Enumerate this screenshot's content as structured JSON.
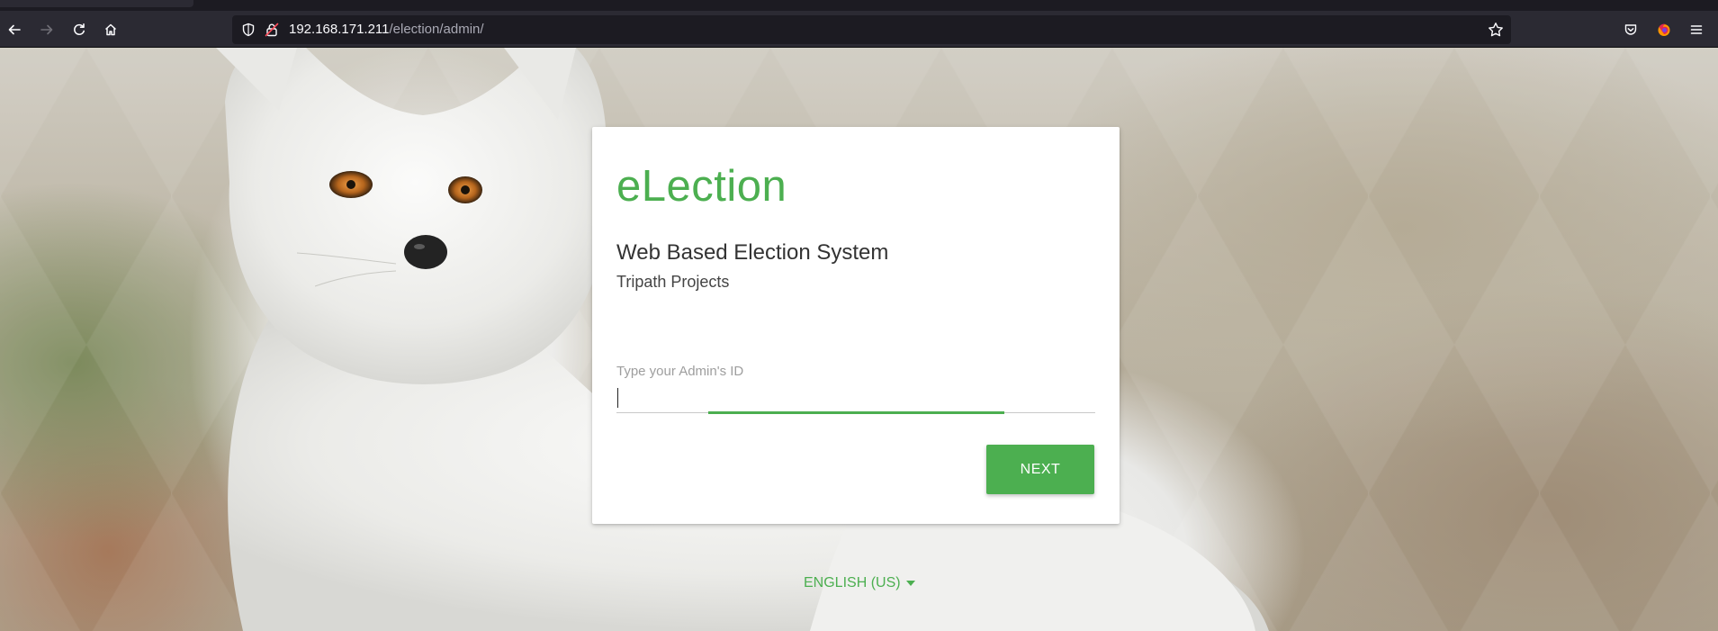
{
  "browser": {
    "url_host": "192.168.171.211",
    "url_path": "/election/admin/"
  },
  "card": {
    "brand": "eLection",
    "subtitle": "Web Based Election System",
    "organization": "Tripath Projects",
    "field_label": "Type your Admin's ID",
    "field_value": "",
    "next_label": "NEXT"
  },
  "footer": {
    "language": "ENGLISH (US)"
  },
  "colors": {
    "accent": "#4caf50",
    "chrome": "#2b2a33",
    "urlbar": "#1c1b22"
  },
  "icons": {
    "back": "arrow-left-icon",
    "forward": "arrow-right-icon",
    "reload": "reload-icon",
    "home": "home-icon",
    "shield": "shield-icon",
    "lock": "insecure-lock-icon",
    "bookmark": "star-icon",
    "pocket": "pocket-icon",
    "extension": "firefox-extension-icon",
    "menu": "hamburger-menu-icon",
    "language_caret": "caret-down-icon"
  }
}
